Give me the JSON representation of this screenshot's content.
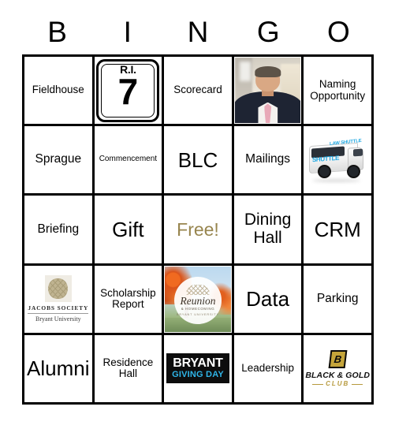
{
  "card": {
    "header_letters": [
      "B",
      "I",
      "N",
      "G",
      "O"
    ],
    "free_color": "#97854e",
    "grid_line_color": "#000000",
    "background": "#ffffff"
  },
  "cells": [
    [
      {
        "type": "text",
        "label": "Fieldhouse",
        "size": "s"
      },
      {
        "type": "route-shield",
        "state_label": "R.I.",
        "route_number": "7"
      },
      {
        "type": "text",
        "label": "Scorecard",
        "size": "s"
      },
      {
        "type": "photo-portrait",
        "label": "President portrait photo"
      },
      {
        "type": "text",
        "label": "Naming Opportunity",
        "size": "s"
      }
    ],
    [
      {
        "type": "text",
        "label": "Sprague",
        "size": "m"
      },
      {
        "type": "text",
        "label": "Commencement",
        "size": "xs"
      },
      {
        "type": "text",
        "label": "BLC",
        "size": "xl"
      },
      {
        "type": "text",
        "label": "Mailings",
        "size": "m"
      },
      {
        "type": "photo-shuttle",
        "bus_side_text": "SHUTTLE",
        "bus_roof_text": "LAW SHUTTLE"
      }
    ],
    [
      {
        "type": "text",
        "label": "Briefing",
        "size": "m"
      },
      {
        "type": "text",
        "label": "Gift",
        "size": "xl"
      },
      {
        "type": "free",
        "label": "Free!"
      },
      {
        "type": "text",
        "label": "Dining Hall",
        "size": "l"
      },
      {
        "type": "text",
        "label": "CRM",
        "size": "xl"
      }
    ],
    [
      {
        "type": "logo-jacobs",
        "name": "JACOBS SOCIETY",
        "sub": "Bryant University"
      },
      {
        "type": "text",
        "label": "Scholarship Report",
        "size": "s"
      },
      {
        "type": "photo-reunion",
        "seal_main": "Reunion",
        "seal_sub": "& HOMECOMING",
        "seal_sub2": "BRYANT UNIVERSITY"
      },
      {
        "type": "text",
        "label": "Data",
        "size": "xl"
      },
      {
        "type": "text",
        "label": "Parking",
        "size": "m"
      }
    ],
    [
      {
        "type": "text",
        "label": "Alumni",
        "size": "xl"
      },
      {
        "type": "text",
        "label": "Residence Hall",
        "size": "s"
      },
      {
        "type": "logo-givingday",
        "top": "BRYANT",
        "bottom": "GIVING DAY"
      },
      {
        "type": "text",
        "label": "Leadership",
        "size": "s"
      },
      {
        "type": "logo-blackgold",
        "mark": "B",
        "name": "BLACK & GOLD",
        "club": "CLUB"
      }
    ]
  ]
}
